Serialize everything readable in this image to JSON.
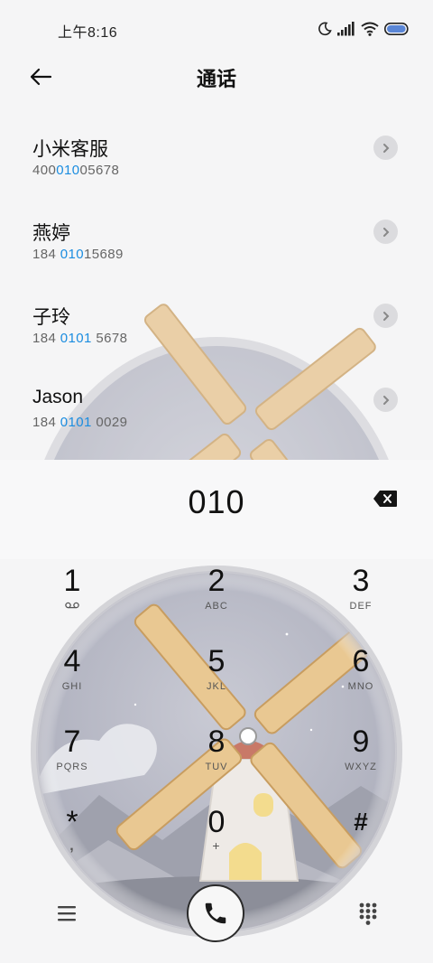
{
  "status_bar": {
    "time": "上午8:16",
    "icons": [
      "moon-icon",
      "signal-icon",
      "wifi-icon",
      "battery-icon"
    ]
  },
  "header": {
    "title": "通话",
    "back_icon": "arrow-left-icon"
  },
  "contacts": [
    {
      "name": "小米客服",
      "number_pre": "400",
      "number_match": "010",
      "number_post": "05678"
    },
    {
      "name": "燕婷",
      "number_pre": "184 ",
      "number_match": "010",
      "number_post": "15689"
    },
    {
      "name": "子玲",
      "number_pre": "184 ",
      "number_match": "0101",
      "number_post": " 5678"
    },
    {
      "name": "Jason",
      "number_pre": "184 ",
      "number_match": "0101",
      "number_post": " 0029"
    }
  ],
  "dialer": {
    "input": "010",
    "keys": [
      {
        "digit": "1",
        "sub": ""
      },
      {
        "digit": "2",
        "sub": "ABC"
      },
      {
        "digit": "3",
        "sub": "DEF"
      },
      {
        "digit": "4",
        "sub": "GHI"
      },
      {
        "digit": "5",
        "sub": "JKL"
      },
      {
        "digit": "6",
        "sub": "MNO"
      },
      {
        "digit": "7",
        "sub": "PQRS"
      },
      {
        "digit": "8",
        "sub": "TUV"
      },
      {
        "digit": "9",
        "sub": "WXYZ"
      },
      {
        "digit": "*",
        "sub": ","
      },
      {
        "digit": "0",
        "sub": "+"
      },
      {
        "digit": "#",
        "sub": ""
      }
    ]
  },
  "bottom_bar": {
    "icons": [
      "menu-icon",
      "phone-icon",
      "keypad-icon"
    ]
  },
  "colors": {
    "match_highlight": "#1b8de0",
    "background": "#f5f5f6",
    "text_primary": "#111111"
  }
}
